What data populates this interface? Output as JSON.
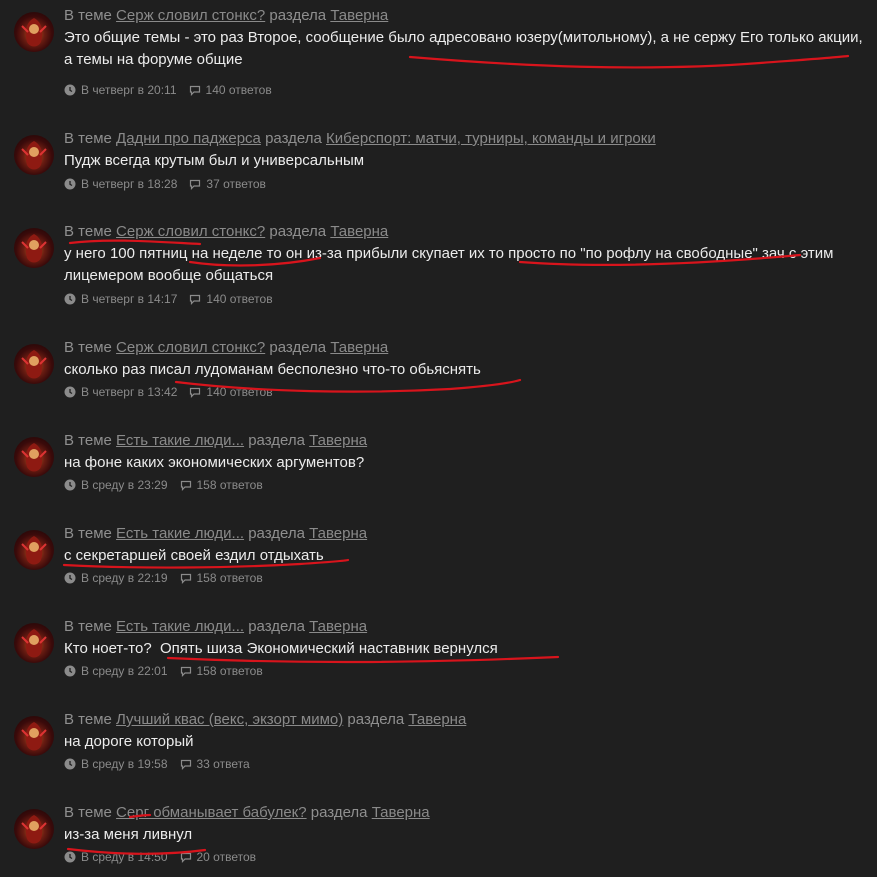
{
  "labels": {
    "in_topic": "В теме",
    "of_section": "раздела"
  },
  "posts": [
    {
      "topic": "Серж словил стонкс?",
      "section": "Таверна",
      "text": "Это общие темы - это раз Второе, сообщение было адресовано юзеру(митольному), а не сержу Его только акции, а темы на форуме общие",
      "time": "В четверг в 20:11",
      "replies": "140 ответов"
    },
    {
      "topic": "Дадни про паджерса",
      "section": "Киберспорт: матчи, турниры, команды и игроки",
      "text": "Пудж всегда крутым был и универсальным",
      "time": "В четверг в 18:28",
      "replies": "37 ответов"
    },
    {
      "topic": "Серж словил стонкс?",
      "section": "Таверна",
      "text": "у него 100 пятниц на неделе то он из-за прибыли скупает их то просто по \"по рофлу на свободные\" зач с этим лицемером вообще общаться",
      "time": "В четверг в 14:17",
      "replies": "140 ответов"
    },
    {
      "topic": "Серж словил стонкс?",
      "section": "Таверна",
      "text": "сколько раз писал лудоманам бесполезно что-то обьяснять",
      "time": "В четверг в 13:42",
      "replies": "140 ответов"
    },
    {
      "topic": "Есть такие люди...",
      "section": "Таверна",
      "text": "на фоне каких экономических аргументов?",
      "time": "В среду в 23:29",
      "replies": "158 ответов"
    },
    {
      "topic": "Есть такие люди...",
      "section": "Таверна",
      "text": "с секретаршей своей ездил отдыхать",
      "time": "В среду в 22:19",
      "replies": "158 ответов"
    },
    {
      "topic": "Есть такие люди...",
      "section": "Таверна",
      "text": "Кто ноет-то?  Опять шиза Экономический наставник вернулся",
      "time": "В среду в 22:01",
      "replies": "158 ответов"
    },
    {
      "topic": "Лучший квас (векс, экзорт мимо)",
      "section": "Таверна",
      "text": "на дороге который",
      "time": "В среду в 19:58",
      "replies": "33 ответа"
    },
    {
      "topic": "Серг обманывает бабулек?",
      "section": "Таверна",
      "text": "из-за меня ливнул",
      "time": "В среду в 14:50",
      "replies": "20 ответов"
    }
  ],
  "colors": {
    "background": "#1f1f1f",
    "text": "#ececec",
    "muted": "#8b8b8b",
    "annotation": "#d8141c"
  },
  "icons": {
    "time": "clock-icon",
    "replies": "speech-bubble-icon"
  }
}
